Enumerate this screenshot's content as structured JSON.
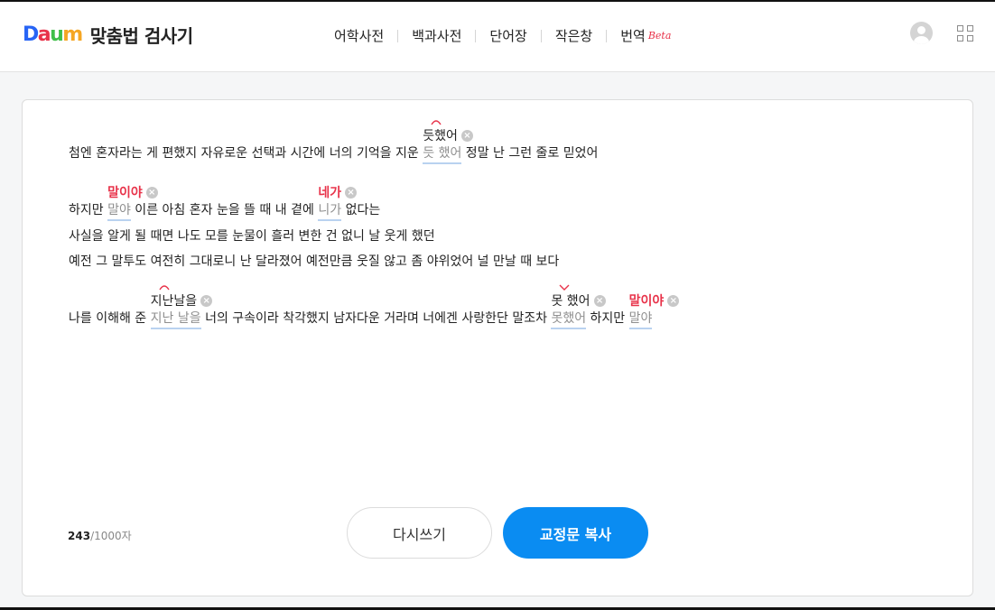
{
  "header": {
    "brand_letters": [
      {
        "ch": "D",
        "color": "#2764f5"
      },
      {
        "ch": "a",
        "color": "#e8334a"
      },
      {
        "ch": "u",
        "color": "#3fbf4a"
      },
      {
        "ch": "m",
        "color": "#f5a623"
      }
    ],
    "service_title": "맞춤법 검사기",
    "nav": [
      "어학사전",
      "백과사전",
      "단어장",
      "작은창",
      "번역"
    ],
    "beta_label": "Beta"
  },
  "editor": {
    "lines": [
      {
        "segments": [
          {
            "text": "첨엔 혼자라는 게 편했지 자유로운 선택과 시간에 너의 기억을 지운 "
          },
          {
            "text": "듯 했어",
            "error": true
          },
          {
            "text": " 정말 난 그런 줄로 믿었어"
          }
        ]
      },
      {
        "segments": [
          {
            "text": "하지만 "
          },
          {
            "text": "말야",
            "error": true
          },
          {
            "text": " 이른 아침 혼자 눈을 뜰 때 내 곁에 "
          },
          {
            "text": "니가",
            "error": true
          },
          {
            "text": " 없다는"
          }
        ]
      },
      {
        "segments": [
          {
            "text": "사실을 알게 될 때면 나도 모를 눈물이 흘러 변한 건 없니 날 웃게 했던"
          }
        ]
      },
      {
        "segments": [
          {
            "text": "예전 그 말투도 여전히 그대로니 난 달라졌어 예전만큼 웃질 않고 좀 야위었어 널 만날 때 보다"
          }
        ]
      },
      {
        "segments": [
          {
            "text": "나를 이해해 준 "
          },
          {
            "text": "지난 날을",
            "error": true
          },
          {
            "text": " 너의 구속이라 착각했지 남자다운 거라며 너에겐 사랑한단 말조차 "
          },
          {
            "text": "못했어",
            "error": true
          },
          {
            "text": " 하지만 "
          },
          {
            "text": "말야",
            "error": true
          }
        ]
      }
    ],
    "suggestions": [
      {
        "text": "듯했어",
        "style": "dark",
        "mark": "join"
      },
      {
        "text": "말이야",
        "style": "red",
        "mark": ""
      },
      {
        "text": "네가",
        "style": "red",
        "mark": ""
      },
      {
        "text": "지난날을",
        "style": "dark",
        "mark": "join"
      },
      {
        "text": "못 했어",
        "style": "dark",
        "mark": "split"
      },
      {
        "text": "말이야",
        "style": "red",
        "mark": ""
      }
    ],
    "remove_glyph": "×",
    "char_count": "243",
    "char_limit": "/1000자"
  },
  "actions": {
    "rewrite_label": "다시쓰기",
    "copy_label": "교정문 복사"
  }
}
